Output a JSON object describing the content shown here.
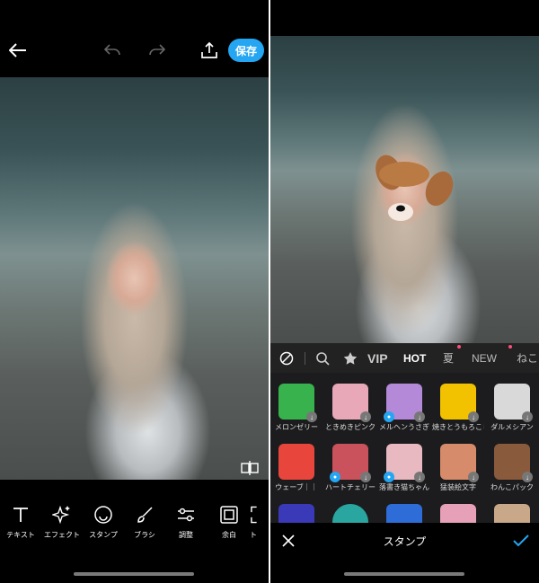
{
  "left": {
    "toolbar": {
      "save_label": "保存"
    },
    "tools": [
      {
        "label": "テキスト",
        "icon": "text-icon"
      },
      {
        "label": "エフェクト",
        "icon": "sparkle-icon"
      },
      {
        "label": "スタンプ",
        "icon": "smiley-icon"
      },
      {
        "label": "ブラシ",
        "icon": "brush-icon"
      },
      {
        "label": "調整",
        "icon": "sliders-icon"
      },
      {
        "label": "余白",
        "icon": "frame-icon"
      },
      {
        "label": "ト",
        "icon": "crop-icon"
      }
    ]
  },
  "right": {
    "categories": {
      "vip": "VIP",
      "hot": "HOT",
      "summer": "夏",
      "new": "NEW",
      "cat": "ねこと"
    },
    "stickers": [
      {
        "name": "メロンゼリー",
        "color": "#37b24d"
      },
      {
        "name": "ときめきピンク",
        "color": "#e8a8b8"
      },
      {
        "name": "メルヘンうさぎ",
        "color": "#b48ad8"
      },
      {
        "name": "焼きとうもろこし",
        "color": "#f2c200"
      },
      {
        "name": "ダルメシアン",
        "color": "#d9d9d9"
      },
      {
        "name": "ウェーブ｜｜",
        "color": "#e8463c"
      },
      {
        "name": "ハートチェリー",
        "color": "#c9525c"
      },
      {
        "name": "落書き猫ちゃん",
        "color": "#e9b9c1"
      },
      {
        "name": "猛装絵文字",
        "color": "#d68b6a"
      },
      {
        "name": "わんこパック",
        "color": "#8a5a3c"
      },
      {
        "name": "",
        "color": "#3a3ab8"
      },
      {
        "name": "",
        "color": "#2aa6a0"
      },
      {
        "name": "",
        "color": "#2e6dd8"
      },
      {
        "name": "",
        "color": "#e6a0b8"
      },
      {
        "name": "",
        "color": "#c9a88a"
      }
    ],
    "bottom": {
      "title": "スタンプ"
    }
  },
  "colors": {
    "accent": "#25a6f2",
    "panel": "#1c1c1e"
  }
}
